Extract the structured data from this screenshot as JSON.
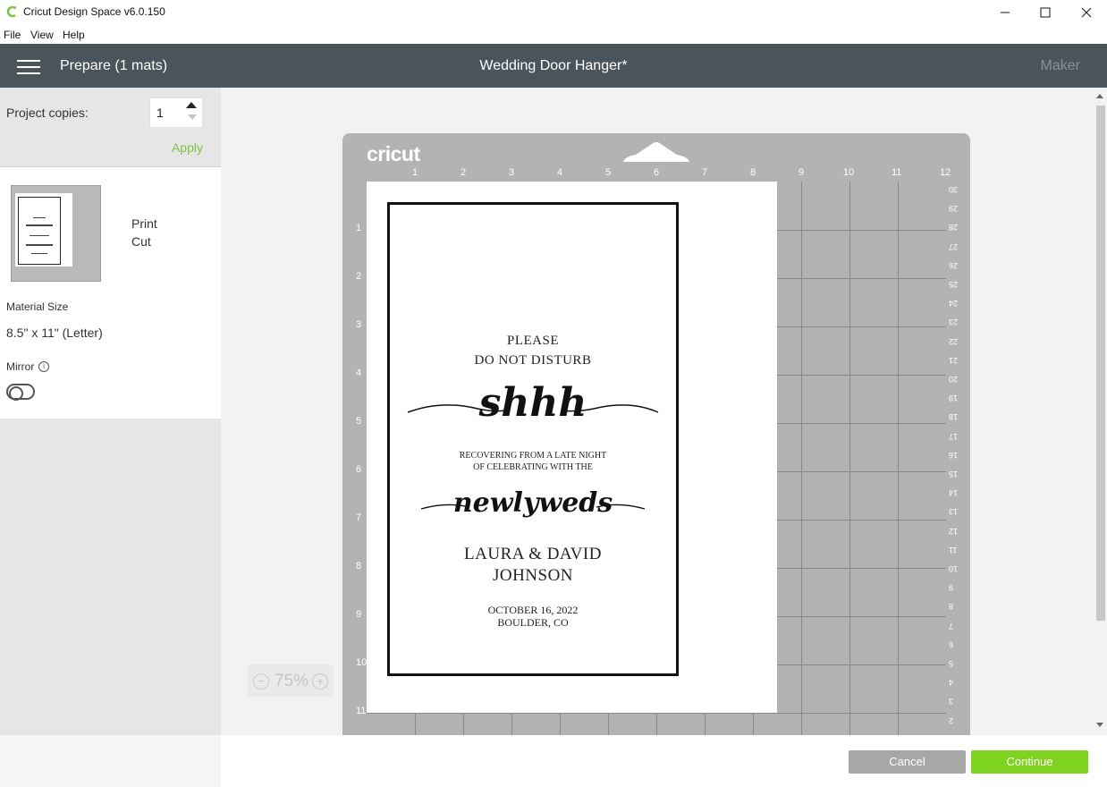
{
  "window": {
    "title": "Cricut Design Space  v6.0.150",
    "minimize_icon": "minimize-icon",
    "maximize_icon": "maximize-icon",
    "close_icon": "close-icon"
  },
  "menu": [
    "File",
    "View",
    "Help"
  ],
  "header": {
    "prepare_title": "Prepare (1 mats)",
    "project_title": "Wedding Door Hanger*",
    "machine": "Maker"
  },
  "left_panel": {
    "copies_label": "Project copies:",
    "copies_value": "1",
    "apply_label": "Apply",
    "mat_labels": [
      "Print",
      "Cut"
    ],
    "material_size_label": "Material Size",
    "material_size_value": "8.5\" x 11\" (Letter)",
    "mirror_label": "Mirror",
    "mirror_on": false
  },
  "mat": {
    "brand": "cricut",
    "top_ruler": [
      "1",
      "2",
      "3",
      "4",
      "5",
      "6",
      "7",
      "8",
      "9",
      "10",
      "11",
      "12"
    ],
    "left_ruler": [
      "1",
      "2",
      "3",
      "4",
      "5",
      "6",
      "7",
      "8",
      "9",
      "10",
      "11"
    ],
    "right_ruler": [
      "30",
      "29",
      "28",
      "27",
      "26",
      "25",
      "24",
      "23",
      "22",
      "21",
      "20",
      "19",
      "18",
      "17",
      "16",
      "15",
      "14",
      "13",
      "12",
      "11",
      "10",
      "9",
      "8",
      "7",
      "6",
      "5",
      "4",
      "3",
      "2"
    ],
    "design": {
      "line1": "PLEASE",
      "line2": "DO NOT DISTURB",
      "script1": "shhh",
      "line3": "RECOVERING FROM A LATE NIGHT",
      "line4": "OF CELEBRATING WITH THE",
      "script2": "newlyweds",
      "names1": "LAURA & DAVID",
      "names2": "JOHNSON",
      "date": "OCTOBER 16, 2022",
      "place": "BOULDER, CO"
    }
  },
  "zoom": {
    "minus": "−",
    "value": "75%",
    "plus": "+"
  },
  "footer": {
    "cancel_label": "Cancel",
    "continue_label": "Continue"
  },
  "colors": {
    "header_bg": "#4a545c",
    "accent_green": "#7ed321",
    "mat_grey": "#b3b3b3"
  }
}
